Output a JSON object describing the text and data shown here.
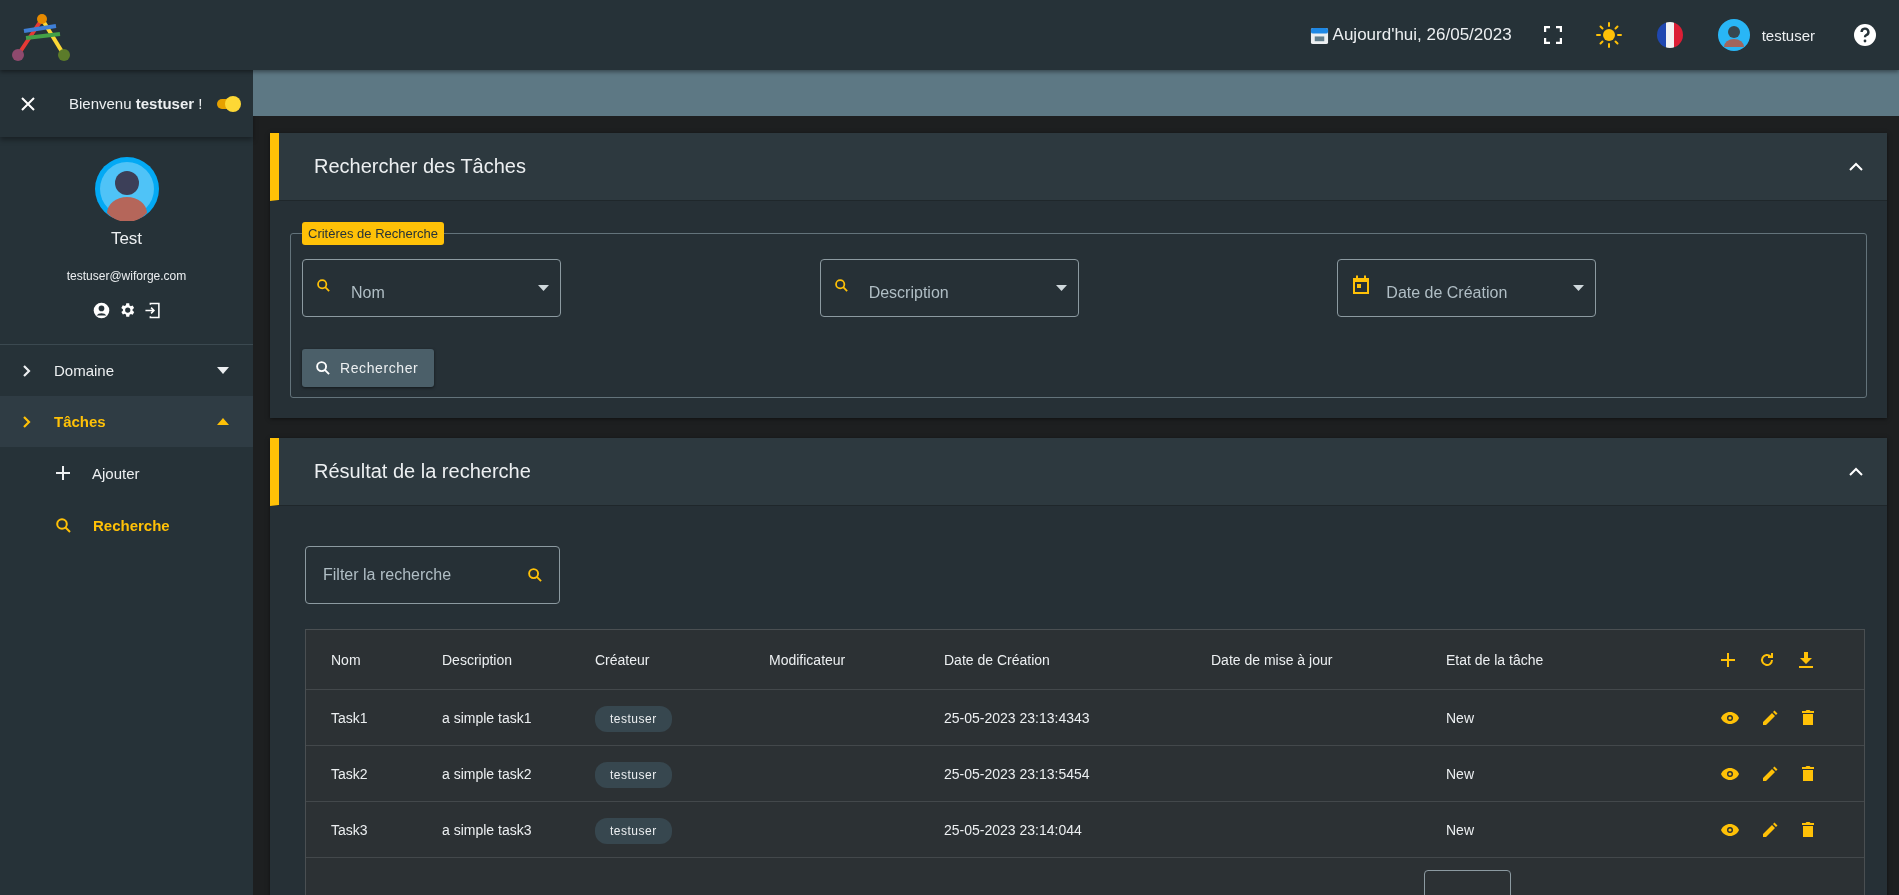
{
  "topbar": {
    "date": "Aujourd'hui, 26/05/2023",
    "username": "testuser"
  },
  "sidebar": {
    "welcome": "Bienvenu **testuser** !",
    "theme_toggle": {
      "on": true
    },
    "profile": {
      "name": "Test",
      "email": "testuser@wiforge.com"
    },
    "nav": [
      {
        "label": "Domaine",
        "expanded": false,
        "selected": false
      },
      {
        "label": "Tâches",
        "expanded": true,
        "selected": true,
        "children": [
          {
            "label": "Ajouter",
            "kind": "add",
            "selected": false
          },
          {
            "label": "Recherche",
            "kind": "search",
            "selected": true
          }
        ]
      }
    ]
  },
  "search_card": {
    "title": "Rechercher des Tâches",
    "expanded": true,
    "legend": "Critères de Recherche",
    "fields": [
      {
        "placeholder": "Nom",
        "kind": "search"
      },
      {
        "placeholder": "Description",
        "kind": "search"
      },
      {
        "placeholder": "Date de Création",
        "kind": "date"
      }
    ],
    "button": "Rechercher"
  },
  "results_card": {
    "title": "Résultat de la recherche",
    "expanded": true,
    "filter": {
      "placeholder": "Filter la recherche"
    },
    "table": {
      "columns": [
        "Nom",
        "Description",
        "Créateur",
        "Modificateur",
        "Date de Création",
        "Date de mise à jour",
        "Etat de la tâche"
      ],
      "rows": [
        {
          "name": "Task1",
          "description": "a simple task1",
          "creator": "testuser",
          "created": "25-05-2023 23:13:4343",
          "state": "New"
        },
        {
          "name": "Task2",
          "description": "a simple task2",
          "creator": "testuser",
          "created": "25-05-2023 23:13:5454",
          "state": "New"
        },
        {
          "name": "Task3",
          "description": "a simple task3",
          "creator": "testuser",
          "created": "25-05-2023 23:14:044",
          "state": "New"
        }
      ]
    }
  }
}
